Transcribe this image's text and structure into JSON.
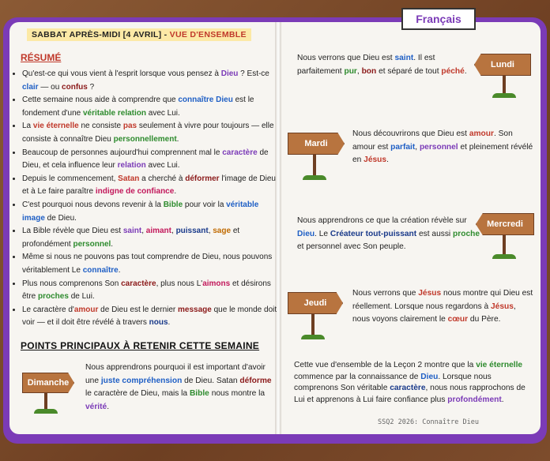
{
  "language_label": "Français",
  "header": {
    "part_a": "SABBAT APRÈS-MIDI [4 AVRIL] - ",
    "part_b": "VUE D'ENSEMBLE"
  },
  "resume_title": "RÉSUMÉ",
  "resume_items": [
    [
      [
        "Qu'est-ce qui vous vient à l'esprit lorsque vous pensez à ",
        ""
      ],
      [
        "Dieu",
        "purple"
      ],
      [
        " ? Est-ce ",
        ""
      ],
      [
        "clair",
        "blue"
      ],
      [
        " — ou ",
        ""
      ],
      [
        "confus",
        "darkred"
      ],
      [
        " ?",
        ""
      ]
    ],
    [
      [
        "Cette semaine nous aide à comprendre que ",
        ""
      ],
      [
        "connaître Dieu",
        "blue"
      ],
      [
        " est le fondement d'une ",
        ""
      ],
      [
        "véritable relation",
        "green"
      ],
      [
        " avec Lui.",
        ""
      ]
    ],
    [
      [
        "La ",
        ""
      ],
      [
        "vie éternelle",
        "red"
      ],
      [
        " ne consiste ",
        ""
      ],
      [
        "pas",
        "red"
      ],
      [
        " seulement à vivre pour toujours — elle consiste à connaître Dieu ",
        ""
      ],
      [
        "personnellement",
        "green"
      ],
      [
        ".",
        ""
      ]
    ],
    [
      [
        "Beaucoup de personnes aujourd'hui comprennent mal le ",
        ""
      ],
      [
        "caractère",
        "purple"
      ],
      [
        " de Dieu, et cela influence leur ",
        ""
      ],
      [
        "relation",
        "purple"
      ],
      [
        " avec Lui.",
        ""
      ]
    ],
    [
      [
        "Depuis le commencement, ",
        ""
      ],
      [
        "Satan",
        "red"
      ],
      [
        " a cherché à ",
        ""
      ],
      [
        "déformer",
        "darkred"
      ],
      [
        " l'image de Dieu et à Le faire paraître ",
        ""
      ],
      [
        "indigne de confiance",
        "pink"
      ],
      [
        ".",
        ""
      ]
    ],
    [
      [
        "C'est pourquoi nous devons revenir à la ",
        ""
      ],
      [
        "Bible",
        "green"
      ],
      [
        " pour voir la ",
        ""
      ],
      [
        "véritable image",
        "blue"
      ],
      [
        " de Dieu.",
        ""
      ]
    ],
    [
      [
        "La Bible révèle que Dieu est ",
        ""
      ],
      [
        "saint",
        "purple"
      ],
      [
        ", ",
        ""
      ],
      [
        "aimant",
        "pink"
      ],
      [
        ", ",
        ""
      ],
      [
        "puissant",
        "darkblue"
      ],
      [
        ", ",
        ""
      ],
      [
        "sage",
        "orange"
      ],
      [
        " et profondément ",
        ""
      ],
      [
        "personnel",
        "green"
      ],
      [
        ".",
        ""
      ]
    ],
    [
      [
        "Même si nous ne pouvons pas tout comprendre de Dieu, nous pouvons véritablement Le ",
        ""
      ],
      [
        "connaître",
        "blue"
      ],
      [
        ".",
        ""
      ]
    ],
    [
      [
        "Plus nous comprenons Son ",
        ""
      ],
      [
        "caractère",
        "darkred"
      ],
      [
        ", plus nous L'",
        ""
      ],
      [
        "aimons",
        "pink"
      ],
      [
        " et désirons être ",
        ""
      ],
      [
        "proches",
        "green"
      ],
      [
        " de Lui.",
        ""
      ]
    ],
    [
      [
        "Le caractère d'",
        ""
      ],
      [
        "amour",
        "red"
      ],
      [
        " de Dieu est le dernier ",
        ""
      ],
      [
        "message",
        "darkred"
      ],
      [
        " que le monde doit voir — et il doit être révélé à travers ",
        ""
      ],
      [
        "nous",
        "darkblue"
      ],
      [
        ".",
        ""
      ]
    ]
  ],
  "points_title": "POINTS PRINCIPAUX À RETENIR CETTE SEMAINE",
  "days": {
    "dimanche": {
      "label": "Dimanche",
      "text": [
        [
          "Nous apprendrons pourquoi il est important d'avoir une ",
          ""
        ],
        [
          "juste compréhension",
          "blue"
        ],
        [
          " de Dieu. Satan ",
          ""
        ],
        [
          "déforme",
          "darkred"
        ],
        [
          " le caractère de Dieu, mais la ",
          ""
        ],
        [
          "Bible",
          "green"
        ],
        [
          " nous montre la ",
          ""
        ],
        [
          "vérité",
          "purple"
        ],
        [
          ".",
          ""
        ]
      ]
    },
    "lundi": {
      "label": "Lundi",
      "text": [
        [
          "Nous verrons que Dieu est ",
          ""
        ],
        [
          "saint",
          "blue"
        ],
        [
          ". Il est parfaitement ",
          ""
        ],
        [
          "pur",
          "green"
        ],
        [
          ", ",
          ""
        ],
        [
          "bon",
          "darkred"
        ],
        [
          " et séparé de tout ",
          ""
        ],
        [
          "péché",
          "red"
        ],
        [
          ".",
          ""
        ]
      ]
    },
    "mardi": {
      "label": "Mardi",
      "text": [
        [
          "Nous découvrirons que Dieu est ",
          ""
        ],
        [
          "amour",
          "red"
        ],
        [
          ". Son amour est ",
          ""
        ],
        [
          "parfait",
          "blue"
        ],
        [
          ", ",
          ""
        ],
        [
          "personnel",
          "purple"
        ],
        [
          " et pleinement révélé en ",
          ""
        ],
        [
          "Jésus",
          "red"
        ],
        [
          ".",
          ""
        ]
      ]
    },
    "mercredi": {
      "label": "Mercredi",
      "text": [
        [
          "Nous apprendrons ce que la création révèle sur ",
          ""
        ],
        [
          "Dieu",
          "blue"
        ],
        [
          ". Le ",
          ""
        ],
        [
          "Créateur tout-puissant",
          "darkblue"
        ],
        [
          " est aussi ",
          ""
        ],
        [
          "proche",
          "green"
        ],
        [
          " et personnel avec Son peuple.",
          ""
        ]
      ]
    },
    "jeudi": {
      "label": "Jeudi",
      "text": [
        [
          "Nous verrons que ",
          ""
        ],
        [
          "Jésus",
          "red"
        ],
        [
          " nous montre qui Dieu est réellement. Lorsque nous regardons à ",
          ""
        ],
        [
          "Jésus",
          "red"
        ],
        [
          ", nous voyons clairement le ",
          ""
        ],
        [
          "cœur",
          "red"
        ],
        [
          " du Père.",
          ""
        ]
      ]
    }
  },
  "conclusion": [
    [
      "Cette vue d'ensemble de la Leçon 2 montre que la ",
      ""
    ],
    [
      "vie éternelle",
      "green"
    ],
    [
      " commence par la connaissance de ",
      ""
    ],
    [
      "Dieu",
      "blue"
    ],
    [
      ". Lorsque nous comprenons Son véritable ",
      ""
    ],
    [
      "caractère",
      "darkblue"
    ],
    [
      ", nous nous rapprochons de Lui et apprenons à Lui faire confiance plus ",
      ""
    ],
    [
      "profondément",
      "purple"
    ],
    [
      ".",
      ""
    ]
  ],
  "footer": "SSQ2 2026: Connaître Dieu"
}
